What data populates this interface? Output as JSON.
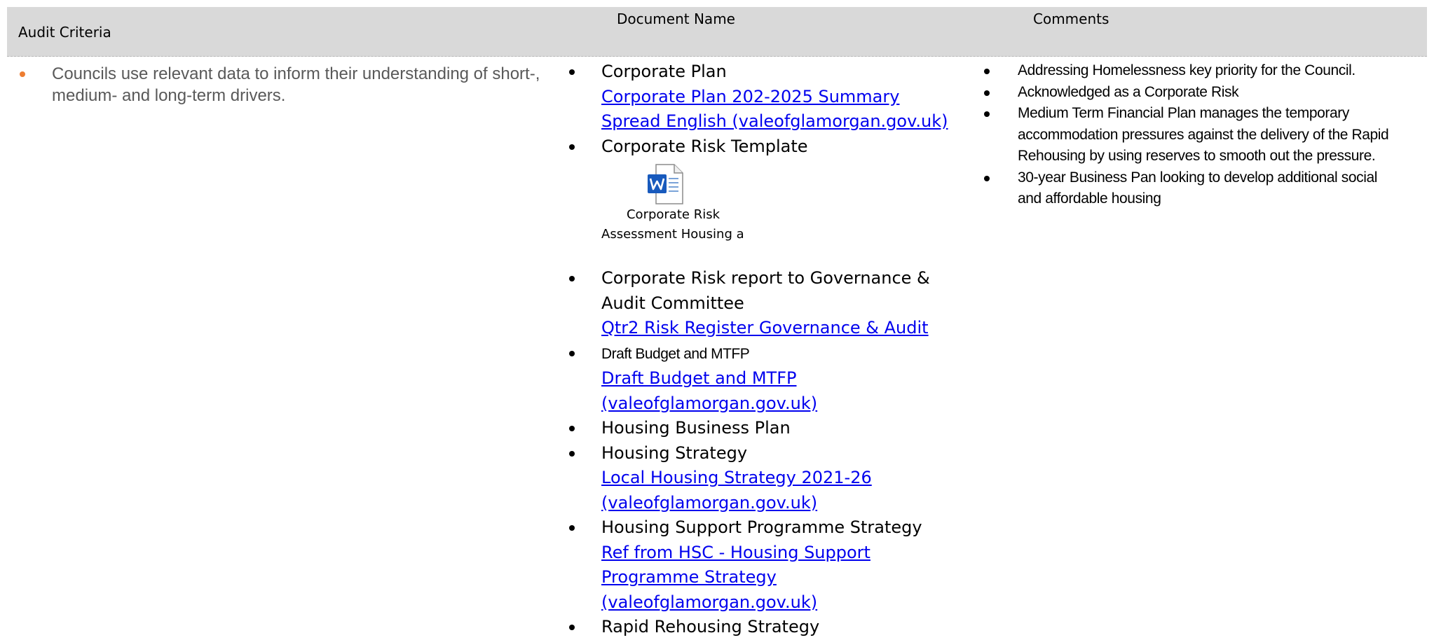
{
  "header": {
    "audit_criteria": "Audit Criteria",
    "document_name": "Document Name",
    "comments": "Comments"
  },
  "criteria": {
    "items": [
      "Councils use relevant data to inform their understanding of short-, medium- and long-term drivers."
    ]
  },
  "documents": {
    "items": [
      {
        "label": "Corporate Plan",
        "link": "Corporate Plan 202-2025 Summary Spread English (valeofglamorgan.gov.uk)"
      },
      {
        "label": "Corporate Risk Template",
        "attachment_caption_1": "Corporate Risk",
        "attachment_caption_2": "Assessment Housing and",
        "attachment_icon": "word-document-icon"
      },
      {
        "label": "Corporate Risk report to Governance & Audit Committee",
        "link": "Qtr2 Risk Register Governance & Audit"
      },
      {
        "label": "Draft Budget and MTFP",
        "link": "Draft Budget and MTFP (valeofglamorgan.gov.uk)"
      },
      {
        "label": "Housing Business Plan"
      },
      {
        "label": "Housing Strategy",
        "link": "Local Housing Strategy 2021-26 (valeofglamorgan.gov.uk)"
      },
      {
        "label": "Housing Support Programme Strategy",
        "link": "Ref from HSC - Housing Support Programme Strategy (valeofglamorgan.gov.uk)"
      },
      {
        "label": "Rapid Rehousing Strategy"
      }
    ]
  },
  "comments": {
    "items": [
      "Addressing Homelessness key priority for the Council.",
      "Acknowledged as a Corporate Risk",
      "Medium Term Financial Plan manages the temporary accommodation pressures against the delivery of the Rapid Rehousing by using reserves to smooth out the pressure.",
      "30-year Business Pan looking to develop additional social and affordable housing"
    ]
  },
  "colors": {
    "header_bg": "#d9d9d9",
    "criteria_text": "#595959",
    "criteria_bullet": "#ed7d31",
    "link": "#0000ee",
    "word_blue": "#185abd"
  }
}
